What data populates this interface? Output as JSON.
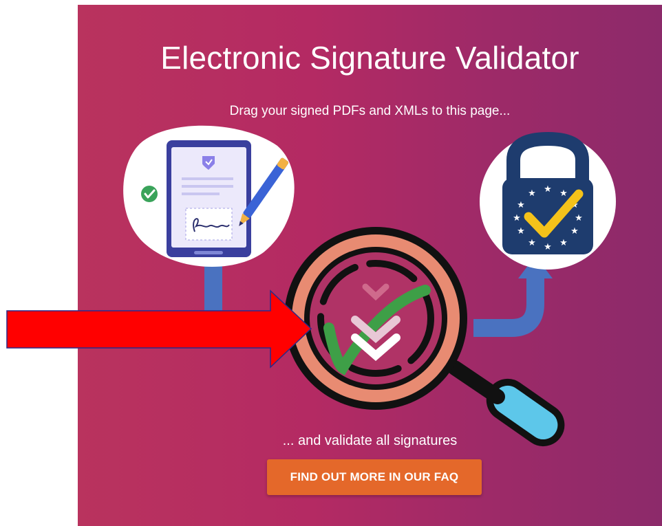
{
  "page": {
    "title": "Electronic Signature Validator",
    "subtitle": "Drag your signed PDFs and XMLs to this page...",
    "caption": "... and validate all signatures",
    "faq_button": "FIND OUT MORE IN OUR FAQ"
  },
  "colors": {
    "panel_start": "#b9335e",
    "panel_end": "#8c2a6a",
    "button": "#e4682a",
    "pipe": "#4a72c0",
    "eu_blue": "#1e3c6e",
    "eu_star": "#ffffff",
    "check_yellow": "#f4c21a",
    "check_green": "#4caf50",
    "arrow_red": "#ff0000"
  },
  "icons": {
    "tablet": "signed-document-tablet-icon",
    "lock": "eu-trust-lock-icon",
    "magnifier": "magnifier-check-icon",
    "pointer": "red-arrow-icon"
  }
}
